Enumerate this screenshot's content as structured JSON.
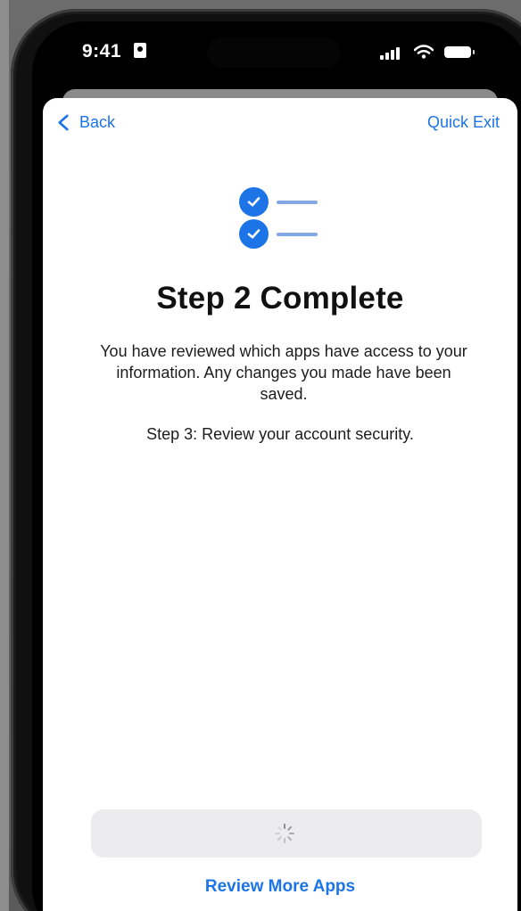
{
  "status_bar": {
    "time": "9:41",
    "signal_icon": "cellular-signal-icon",
    "wifi_icon": "wifi-icon",
    "battery_icon": "battery-icon"
  },
  "navigation": {
    "back_label": "Back",
    "quick_exit_label": "Quick Exit"
  },
  "content": {
    "title": "Step 2 Complete",
    "description": "You have reviewed which apps have access to your information. Any changes you made have been saved.",
    "next_step": "Step 3: Review your account security."
  },
  "actions": {
    "primary_state": "loading",
    "secondary_label": "Review More Apps"
  },
  "colors": {
    "accent": "#1d74e7",
    "check_line": "#82a9e4",
    "button_bg": "#ececee"
  }
}
